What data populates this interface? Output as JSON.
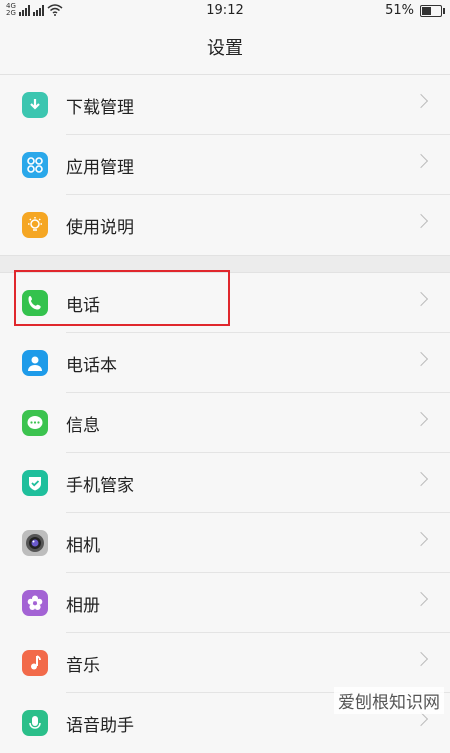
{
  "status_bar": {
    "net_top": "4G",
    "net_bottom": "2G",
    "time": "19:12",
    "battery": "51%",
    "battery_level": 0.51
  },
  "header": {
    "title": "设置"
  },
  "groups": [
    {
      "items": [
        {
          "label": "下载管理",
          "icon": "download-icon",
          "color": "#3cc6b0"
        },
        {
          "label": "应用管理",
          "icon": "apps-icon",
          "color": "#2aa8ea"
        },
        {
          "label": "使用说明",
          "icon": "lightbulb-icon",
          "color": "#f5a623"
        }
      ]
    },
    {
      "items": [
        {
          "label": "电话",
          "icon": "phone-icon",
          "color": "#34c24d"
        },
        {
          "label": "电话本",
          "icon": "contacts-icon",
          "color": "#1e9be9"
        },
        {
          "label": "信息",
          "icon": "message-icon",
          "color": "#3cc34f"
        },
        {
          "label": "手机管家",
          "icon": "shield-icon",
          "color": "#1fbf9c"
        },
        {
          "label": "相机",
          "icon": "camera-icon",
          "color": "#bdbdbd"
        },
        {
          "label": "相册",
          "icon": "flower-icon",
          "color": "#a363d4"
        },
        {
          "label": "音乐",
          "icon": "music-icon",
          "color": "#f26a4a"
        },
        {
          "label": "语音助手",
          "icon": "microphone-icon",
          "color": "#2bbf8a"
        }
      ]
    }
  ],
  "watermark": "爱刨根知识网"
}
